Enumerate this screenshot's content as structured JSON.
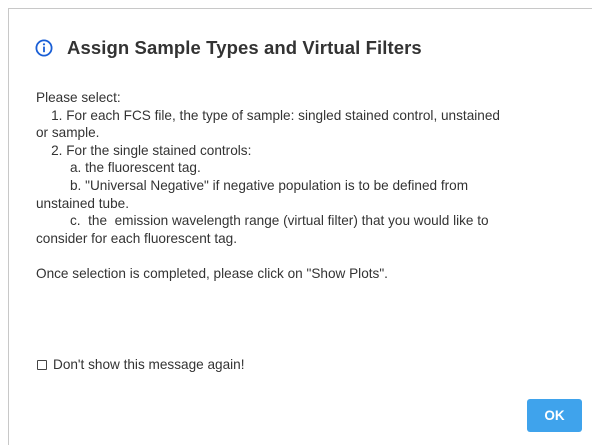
{
  "dialog": {
    "title": "Assign Sample Types and Virtual Filters",
    "icon": "info-circle-icon",
    "accent_color": "#3fa3ec",
    "lines": [
      "Please select:",
      "    1. For each FCS file, the type of sample: singled stained control, unstained",
      "or sample.",
      "    2. For the single stained controls:",
      "         a. the fluorescent tag.",
      "         b. \"Universal Negative\" if negative population is to be defined from",
      "unstained tube.",
      "         c.  the  emission wavelength range (virtual filter) that you would like to",
      "consider for each fluorescent tag."
    ],
    "closing_line": "Once selection is completed, please click on \"Show Plots\".",
    "checkbox_label": "Don't show this message again!",
    "checkbox_checked": false,
    "ok_label": "OK"
  }
}
